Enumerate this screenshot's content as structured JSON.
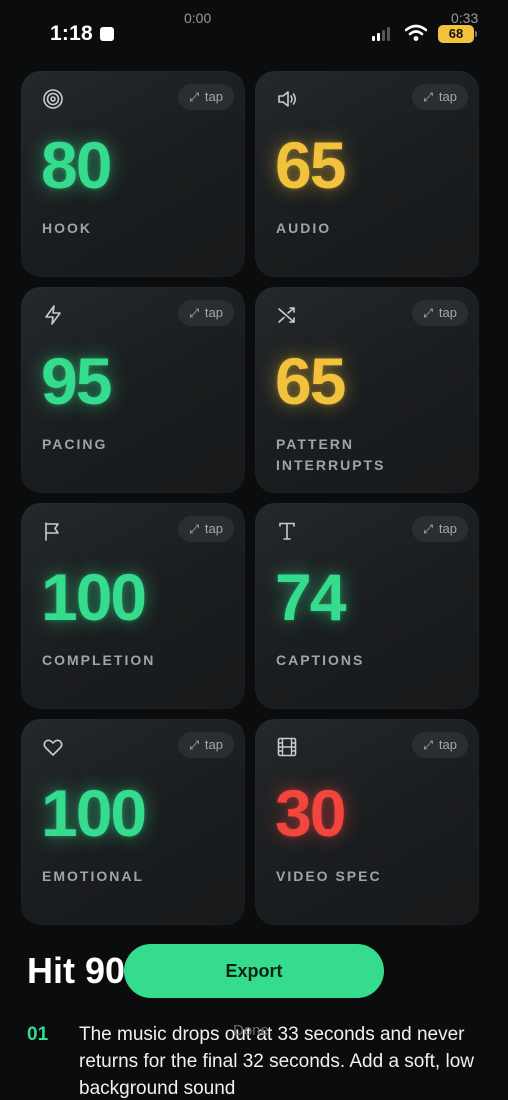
{
  "status_bar": {
    "clock": "1:18",
    "media_time_start": "0:00",
    "media_time_end": "0:33",
    "battery": "68"
  },
  "tap_label": "tap",
  "cards": [
    {
      "icon": "target-icon",
      "score": "80",
      "label": "HOOK",
      "color": "#35dc8d"
    },
    {
      "icon": "speaker-icon",
      "score": "65",
      "label": "AUDIO",
      "color": "#f3c23c"
    },
    {
      "icon": "lightning-icon",
      "score": "95",
      "label": "PACING",
      "color": "#35dc8d"
    },
    {
      "icon": "shuffle-icon",
      "score": "65",
      "label": "PATTERN INTERRUPTS",
      "color": "#f3c23c"
    },
    {
      "icon": "flag-icon",
      "score": "100",
      "label": "COMPLETION",
      "color": "#35dc8d"
    },
    {
      "icon": "text-t-icon",
      "score": "74",
      "label": "CAPTIONS",
      "color": "#35dc8d"
    },
    {
      "icon": "heart-icon",
      "score": "100",
      "label": "EMOTIONAL",
      "color": "#35dc8d"
    },
    {
      "icon": "film-icon",
      "score": "30",
      "label": "VIDEO SPEC",
      "color": "#f2453e"
    }
  ],
  "heading": "Hit 90",
  "export_label": "Export",
  "done_label": "Done",
  "tip": {
    "number": "01",
    "text": "The music drops out at 33 seconds and never returns for the final 32 seconds. Add a soft, low background sound"
  }
}
